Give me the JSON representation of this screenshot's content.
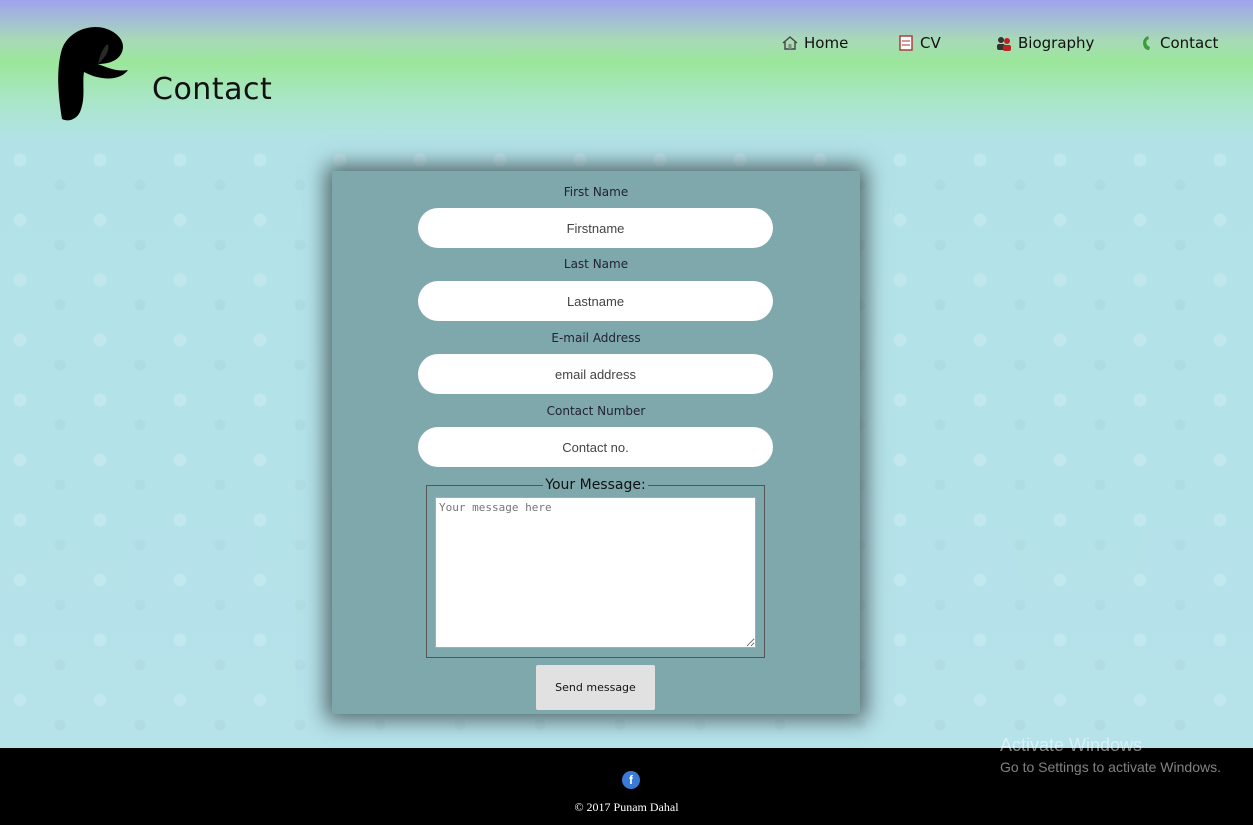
{
  "header": {
    "title": "Contact",
    "nav": [
      {
        "label": "Home",
        "icon": "home-icon"
      },
      {
        "label": "CV",
        "icon": "document-icon"
      },
      {
        "label": "Biography",
        "icon": "people-icon"
      },
      {
        "label": "Contact",
        "icon": "phone-icon"
      }
    ]
  },
  "form": {
    "first_name_label": "First Name",
    "first_name_placeholder": "Firstname",
    "last_name_label": "Last Name",
    "last_name_placeholder": "Lastname",
    "email_label": "E-mail Address",
    "email_placeholder": "email address",
    "contact_label": "Contact Number",
    "contact_placeholder": "Contact no.",
    "message_legend": "Your Message:",
    "message_placeholder": "Your message here",
    "send_label": "Send message"
  },
  "footer": {
    "social_icon": "f",
    "copyright": "© 2017 Punam Dahal"
  },
  "watermark": {
    "title": "Activate Windows",
    "subtitle": "Go to Settings to activate Windows."
  },
  "colors": {
    "panel": "#7fa8ad",
    "page": "#b6e2ea",
    "footer": "#000000",
    "facebook": "#3b7bd8"
  }
}
